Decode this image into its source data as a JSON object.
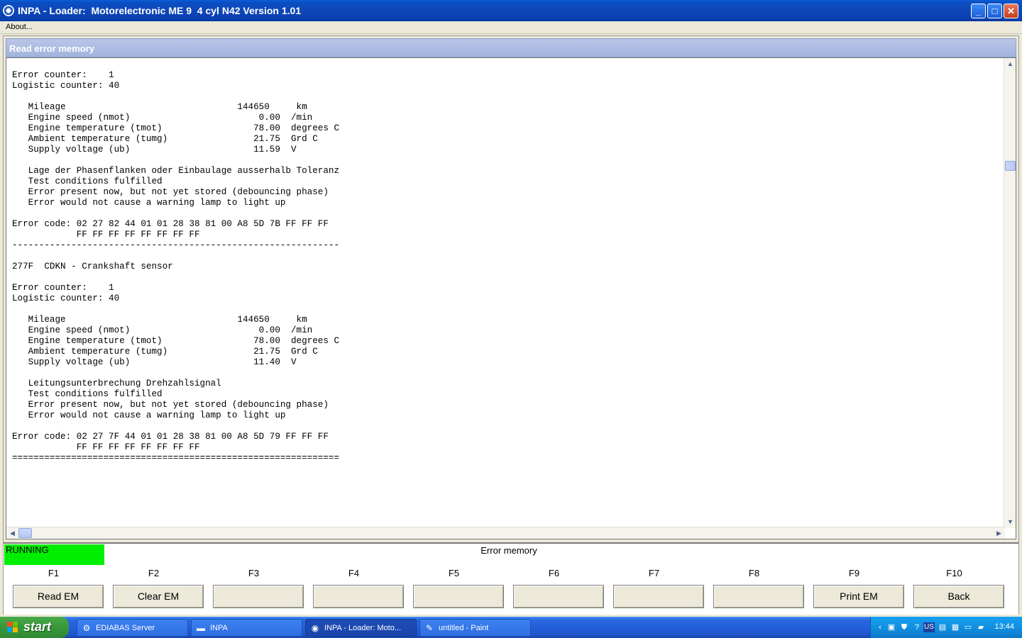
{
  "window": {
    "title": "INPA - Loader:  Motorelectronic ME 9  4 cyl N42 Version 1.01",
    "controls": {
      "minimize": "_",
      "maximize": "□",
      "close": "✕"
    }
  },
  "menu": {
    "items": [
      "About..."
    ]
  },
  "panel": {
    "header": "Read error memory"
  },
  "output": {
    "lines": [
      "Error counter:    1",
      "Logistic counter: 40",
      "",
      "   Mileage                                144650     km",
      "   Engine speed (nmot)                        0.00  /min",
      "   Engine temperature (tmot)                 78.00  degrees C",
      "   Ambient temperature (tumg)                21.75  Grd C",
      "   Supply voltage (ub)                       11.59  V",
      "",
      "   Lage der Phasenflanken oder Einbaulage ausserhalb Toleranz",
      "   Test conditions fulfilled",
      "   Error present now, but not yet stored (debouncing phase)",
      "   Error would not cause a warning lamp to light up",
      "",
      "Error code: 02 27 82 44 01 01 28 38 81 00 A8 5D 7B FF FF FF",
      "            FF FF FF FF FF FF FF FF",
      "-------------------------------------------------------------",
      "",
      "277F  CDKN - Crankshaft sensor",
      "",
      "Error counter:    1",
      "Logistic counter: 40",
      "",
      "   Mileage                                144650     km",
      "   Engine speed (nmot)                        0.00  /min",
      "   Engine temperature (tmot)                 78.00  degrees C",
      "   Ambient temperature (tumg)                21.75  Grd C",
      "   Supply voltage (ub)                       11.40  V",
      "",
      "   Leitungsunterbrechung Drehzahlsignal",
      "   Test conditions fulfilled",
      "   Error present now, but not yet stored (debouncing phase)",
      "   Error would not cause a warning lamp to light up",
      "",
      "Error code: 02 27 7F 44 01 01 28 38 81 00 A8 5D 79 FF FF FF",
      "            FF FF FF FF FF FF FF FF",
      "============================================================="
    ]
  },
  "status": {
    "state": "RUNNING",
    "state_color": "#00ee00",
    "title": "Error memory"
  },
  "function_keys": [
    {
      "key": "F1",
      "label": "Read EM"
    },
    {
      "key": "F2",
      "label": "Clear EM"
    },
    {
      "key": "F3",
      "label": ""
    },
    {
      "key": "F4",
      "label": ""
    },
    {
      "key": "F5",
      "label": ""
    },
    {
      "key": "F6",
      "label": ""
    },
    {
      "key": "F7",
      "label": ""
    },
    {
      "key": "F8",
      "label": ""
    },
    {
      "key": "F9",
      "label": "Print EM"
    },
    {
      "key": "F10",
      "label": "Back"
    }
  ],
  "taskbar": {
    "start_label": "start",
    "tasks": [
      {
        "label": "EDIABAS Server",
        "icon": "ediabas-icon"
      },
      {
        "label": "INPA",
        "icon": "folder-icon"
      },
      {
        "label": "INPA - Loader:  Moto...",
        "icon": "bmw-icon",
        "active": true
      },
      {
        "label": "untitled - Paint",
        "icon": "paint-icon"
      }
    ],
    "tray": {
      "language": "US",
      "clock": "13:44"
    }
  }
}
